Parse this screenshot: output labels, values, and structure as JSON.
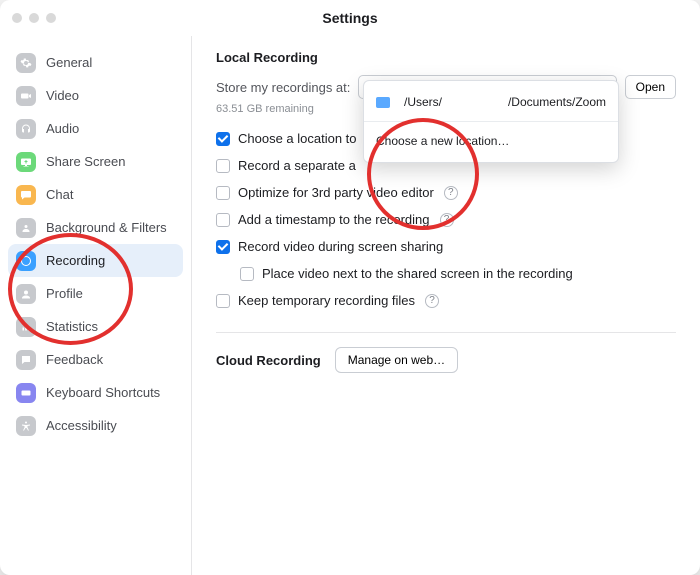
{
  "window": {
    "title": "Settings"
  },
  "sidebar": {
    "items": [
      {
        "key": "general",
        "label": "General"
      },
      {
        "key": "video",
        "label": "Video"
      },
      {
        "key": "audio",
        "label": "Audio"
      },
      {
        "key": "share-screen",
        "label": "Share Screen"
      },
      {
        "key": "chat",
        "label": "Chat"
      },
      {
        "key": "background-filters",
        "label": "Background & Filters"
      },
      {
        "key": "recording",
        "label": "Recording",
        "selected": true
      },
      {
        "key": "profile",
        "label": "Profile"
      },
      {
        "key": "statistics",
        "label": "Statistics"
      },
      {
        "key": "feedback",
        "label": "Feedback"
      },
      {
        "key": "keyboard-shortcuts",
        "label": "Keyboard Shortcuts"
      },
      {
        "key": "accessibility",
        "label": "Accessibility"
      }
    ]
  },
  "local": {
    "heading": "Local Recording",
    "store_label": "Store my recordings at:",
    "path_prefix": "/Users/",
    "path_suffix": "/Documents/Z…",
    "open": "Open",
    "remaining": "63.51 GB remaining",
    "options": [
      {
        "key": "choose-location-end",
        "label": "Choose a location to",
        "checked": true,
        "truncated": true
      },
      {
        "key": "separate-audio",
        "label": "Record a separate a",
        "checked": false,
        "truncated": true
      },
      {
        "key": "optimize-3rd-party",
        "label": "Optimize for 3rd party video editor",
        "checked": false,
        "help": true
      },
      {
        "key": "add-timestamp",
        "label": "Add a timestamp to the recording",
        "checked": false,
        "help": true
      },
      {
        "key": "record-during-share",
        "label": "Record video during screen sharing",
        "checked": true
      },
      {
        "key": "place-next",
        "label": "Place video next to the shared screen in the recording",
        "checked": false,
        "indent": true
      },
      {
        "key": "keep-temp",
        "label": "Keep temporary recording files",
        "checked": false,
        "help": true
      }
    ]
  },
  "dropdown": {
    "current_prefix": "/Users/",
    "current_suffix": "/Documents/Zoom",
    "choose_new": "Choose a new location…"
  },
  "cloud": {
    "heading": "Cloud Recording",
    "manage": "Manage on web…"
  }
}
